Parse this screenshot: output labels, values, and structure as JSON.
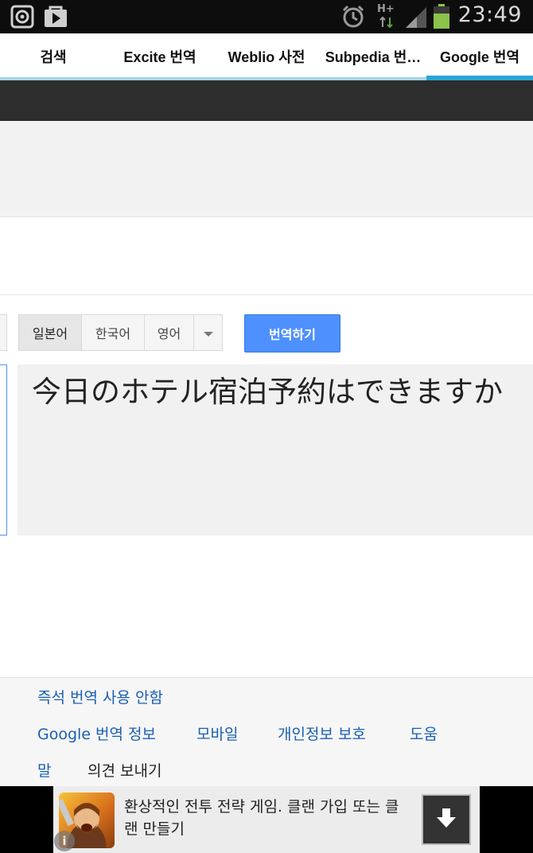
{
  "status_bar": {
    "time": "23:49",
    "network_label": "H+",
    "left_icons": [
      "media-player-icon",
      "play-store-icon"
    ],
    "right_icons": [
      "alarm-icon",
      "network-icon",
      "signal-icon",
      "battery-icon"
    ],
    "battery_color": "#8bc34a"
  },
  "tabs": [
    {
      "label": "검색",
      "active": false
    },
    {
      "label": "Excite 번역",
      "active": false
    },
    {
      "label": "Weblio 사전",
      "active": false
    },
    {
      "label": "Subpedia 번…",
      "active": false
    },
    {
      "label": "Google 번역",
      "active": true
    }
  ],
  "accent_color": "#2aa6d6",
  "translator": {
    "languages": [
      "일본어",
      "한국어",
      "영어"
    ],
    "selected_language": "일본어",
    "translate_button": "번역하기",
    "result_text": "今日のホテル宿泊予約はできますか"
  },
  "footer": {
    "instant_translate_link": "즉석 번역 사용 안함",
    "links": [
      "Google 번역 정보",
      "모바일",
      "개인정보 보호",
      "도움"
    ],
    "help_continuation": "말",
    "feedback_text": "의견 보내기"
  },
  "ad": {
    "text": "환상적인 전투 전략 게임. 클랜 가입 또는 클랜 만들기",
    "info_label": "i"
  }
}
